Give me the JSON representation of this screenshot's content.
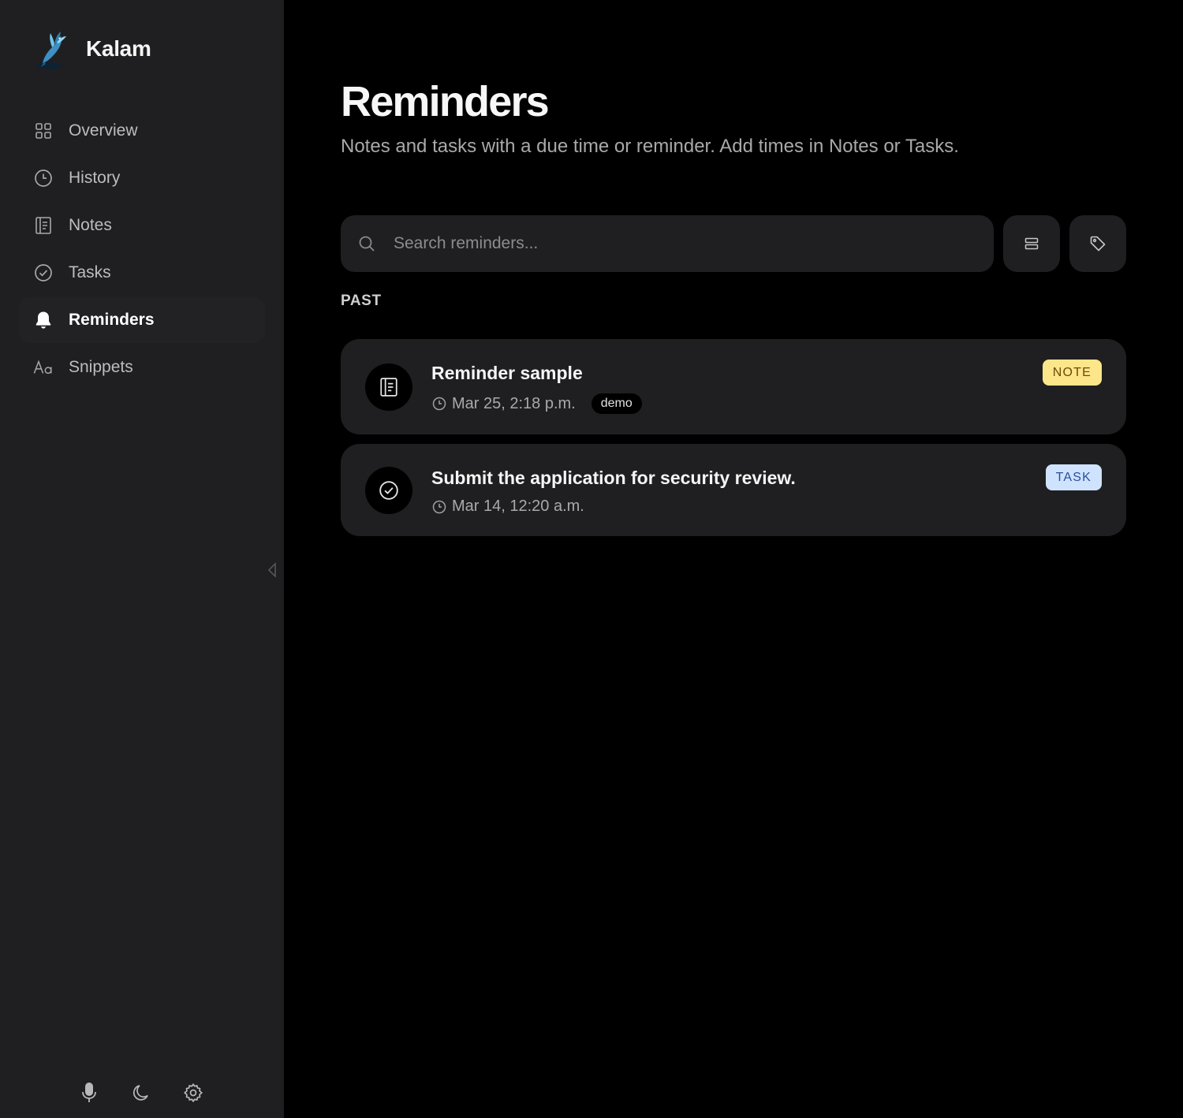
{
  "app": {
    "name": "Kalam"
  },
  "sidebar": {
    "items": [
      {
        "label": "Overview",
        "icon": "grid-icon",
        "active": false
      },
      {
        "label": "History",
        "icon": "clock-icon",
        "active": false
      },
      {
        "label": "Notes",
        "icon": "note-icon",
        "active": false
      },
      {
        "label": "Tasks",
        "icon": "check-circle-icon",
        "active": false
      },
      {
        "label": "Reminders",
        "icon": "bell-icon",
        "active": true
      },
      {
        "label": "Snippets",
        "icon": "text-aa-icon",
        "active": false
      }
    ],
    "bottom_tools": [
      "microphone-icon",
      "moon-icon",
      "gear-icon"
    ]
  },
  "page": {
    "title": "Reminders",
    "subtitle": "Notes and tasks with a due time or reminder. Add times in Notes or Tasks."
  },
  "search": {
    "placeholder": "Search reminders..."
  },
  "sections": [
    {
      "label": "PAST",
      "items": [
        {
          "title": "Reminder sample",
          "time": "Mar 25, 2:18 p.m.",
          "tag": "demo",
          "type": "NOTE",
          "icon": "note-icon"
        },
        {
          "title": "Submit the application for security review.",
          "time": "Mar 14, 12:20 a.m.",
          "tag": "",
          "type": "TASK",
          "icon": "check-circle-icon"
        }
      ]
    }
  ],
  "colors": {
    "sidebar_bg": "#1f1f21",
    "main_bg": "#000000",
    "note_badge": "#fde68a",
    "task_badge": "#cfe3ff"
  }
}
